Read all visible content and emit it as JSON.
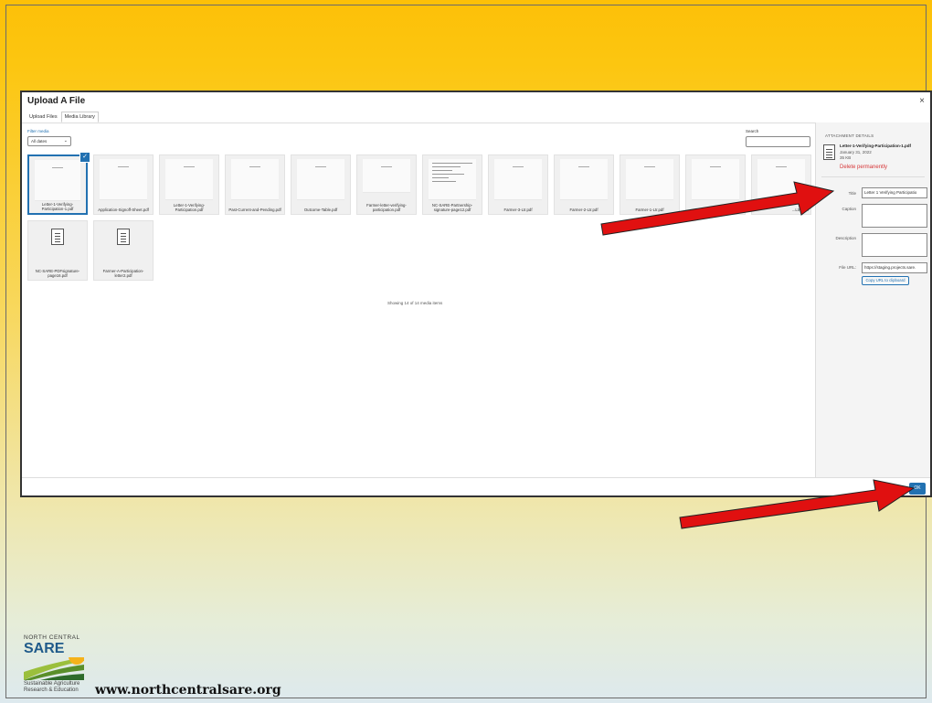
{
  "modal": {
    "title": "Upload A File",
    "close": "×",
    "tabs": [
      "Upload Files",
      "Media Library"
    ]
  },
  "filter": {
    "label": "Filter media",
    "value": "All dates"
  },
  "search": {
    "label": "Search"
  },
  "media_items": [
    {
      "name": "Letter-1-Verifying-Participation-1.pdf",
      "selected": true
    },
    {
      "name": "Application-Signoff-Sheet.pdf"
    },
    {
      "name": "Letter-1-Verifying-Participation.pdf"
    },
    {
      "name": "Past-Current-and-Pending.pdf"
    },
    {
      "name": "Outcome-Table.pdf"
    },
    {
      "name": "Farmer-letter-verifying-participation.pdf"
    },
    {
      "name": "NC-SARE-Partnership-signature-page12.pdf"
    },
    {
      "name": "Farmer-3-Ltr.pdf"
    },
    {
      "name": "Farmer-2-Ltr.pdf"
    },
    {
      "name": "Farmer-1-Ltr.pdf"
    },
    {
      "name": ""
    },
    {
      "name": "...Ltr1.pdf"
    },
    {
      "name": "NC-SARE-PDFsignature-page16.pdf"
    },
    {
      "name": "Farmer-A-Participation-letter2.pdf"
    }
  ],
  "showing_text": "Showing 14 of 14 media items",
  "attachment": {
    "heading": "ATTACHMENT DETAILS",
    "filename": "Letter-1-Verifying-Participation-1.pdf",
    "date": "January 31, 2022",
    "size": "35 KB",
    "delete": "Delete permanently",
    "title_label": "Title",
    "title_value": "Letter 1 Verifying Participatio",
    "caption_label": "Caption",
    "description_label": "Description",
    "url_label": "File URL:",
    "url_value": "https://staging.projects.sare.",
    "copy_button": "Copy URL to clipboard"
  },
  "ok_button": "OK",
  "logo": {
    "line1": "NORTH CENTRAL",
    "line2": "SARE",
    "line3": "Sustainable Agriculture",
    "line4": "Research & Education"
  },
  "website": "www.northcentralsare.org",
  "colors": {
    "accent": "#2271b1",
    "arrow": "#e01010",
    "danger": "#d63638",
    "background_top": "#fdc008"
  }
}
